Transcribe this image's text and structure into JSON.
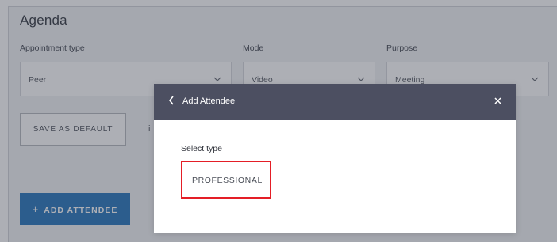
{
  "agenda": {
    "title": "Agenda",
    "fields": [
      {
        "label": "Appointment type",
        "value": "Peer"
      },
      {
        "label": "Mode",
        "value": "Video"
      },
      {
        "label": "Purpose",
        "value": "Meeting"
      }
    ],
    "save_default_label": "SAVE AS DEFAULT",
    "add_attendee_label": "ADD ATTENDEE",
    "add_attendee_icon": "+"
  },
  "modal": {
    "title": "Add Attendee",
    "select_type_label": "Select type",
    "options": [
      "PROFESSIONAL"
    ]
  },
  "colors": {
    "primary": "#2f7bbf",
    "modal_header": "#4c4f61",
    "highlight": "#e41e26"
  }
}
